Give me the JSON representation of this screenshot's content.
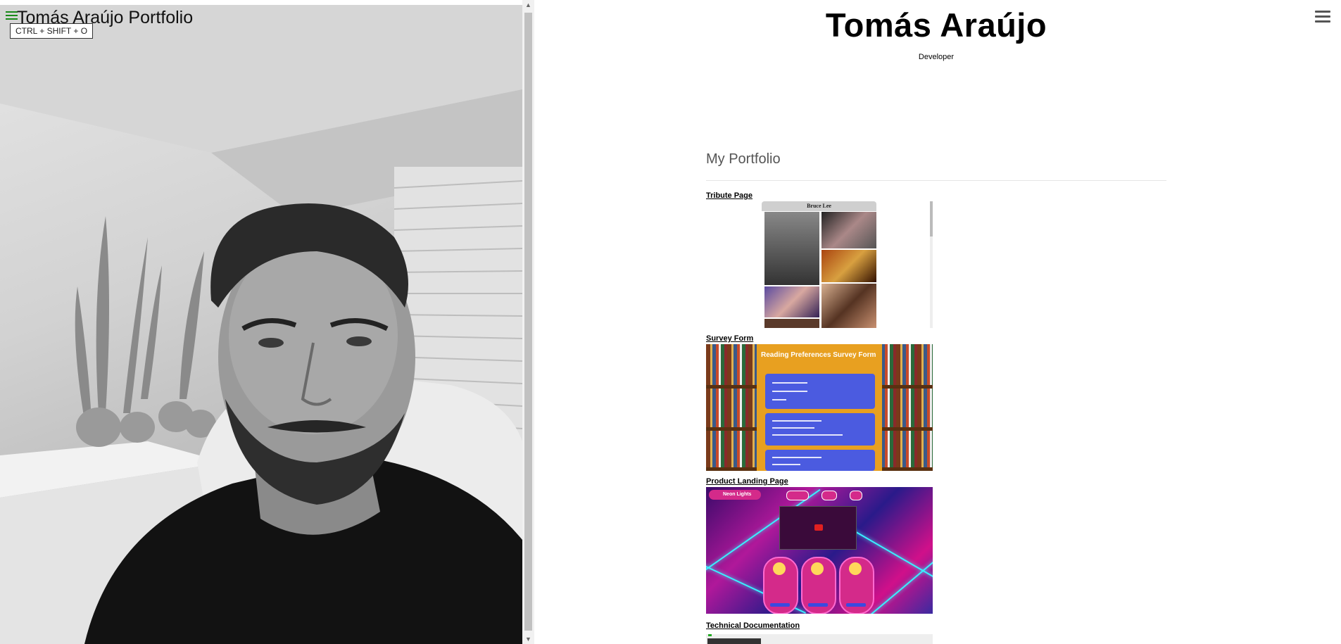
{
  "left_panel": {
    "title": "Tomás Araújo Portfolio",
    "shortcut": "CTRL + SHIFT + O",
    "photo_icon": "portrait-photo"
  },
  "header": {
    "name": "Tomás Araújo",
    "role": "Developer"
  },
  "portfolio": {
    "section_title": "My Portfolio",
    "projects": [
      {
        "label": "Tribute Page",
        "preview_header": "Bruce Lee"
      },
      {
        "label": "Survey Form",
        "preview_header": "Reading Preferences Survey Form"
      },
      {
        "label": "Product Landing Page",
        "preview_header": "Neon Lights"
      },
      {
        "label": "Technical Documentation"
      }
    ]
  },
  "icons": {
    "left_menu": "menu-icon",
    "right_menu": "hamburger-icon"
  },
  "colors": {
    "left_menu_icon": "#1a8a1a",
    "survey_bg": "#e8a020",
    "survey_card": "#4b5be0",
    "neon_pink": "#d42a8a",
    "neon_cyan": "#3af0ff"
  }
}
